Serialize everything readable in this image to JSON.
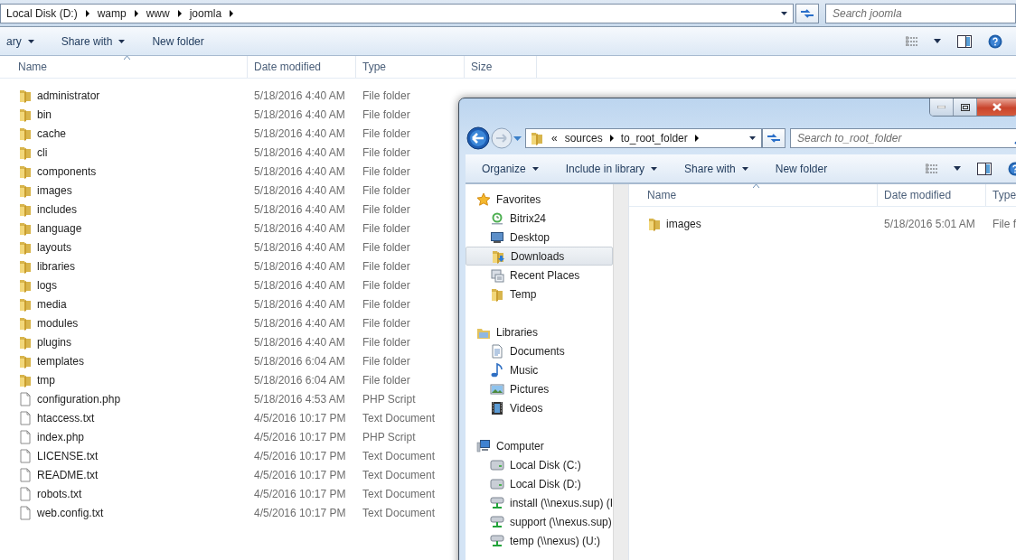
{
  "back_window": {
    "address_bar": {
      "breadcrumbs": [
        "Local Disk (D:)",
        "wamp",
        "www",
        "joomla"
      ]
    },
    "search": {
      "placeholder": "Search joomla"
    },
    "toolbar": [
      {
        "label": "ary",
        "dropdown": true
      },
      {
        "label": "Share with",
        "dropdown": true
      },
      {
        "label": "New folder",
        "dropdown": false
      }
    ],
    "columns": [
      {
        "label": "Name",
        "sorted": true
      },
      {
        "label": "Date modified",
        "sorted": false
      },
      {
        "label": "Type",
        "sorted": false
      },
      {
        "label": "Size",
        "sorted": false
      }
    ],
    "files": [
      {
        "name": "administrator",
        "date_modified": "5/18/2016 4:40 AM",
        "type": "File folder",
        "kind": "folder"
      },
      {
        "name": "bin",
        "date_modified": "5/18/2016 4:40 AM",
        "type": "File folder",
        "kind": "folder"
      },
      {
        "name": "cache",
        "date_modified": "5/18/2016 4:40 AM",
        "type": "File folder",
        "kind": "folder"
      },
      {
        "name": "cli",
        "date_modified": "5/18/2016 4:40 AM",
        "type": "File folder",
        "kind": "folder"
      },
      {
        "name": "components",
        "date_modified": "5/18/2016 4:40 AM",
        "type": "File folder",
        "kind": "folder"
      },
      {
        "name": "images",
        "date_modified": "5/18/2016 4:40 AM",
        "type": "File folder",
        "kind": "folder"
      },
      {
        "name": "includes",
        "date_modified": "5/18/2016 4:40 AM",
        "type": "File folder",
        "kind": "folder"
      },
      {
        "name": "language",
        "date_modified": "5/18/2016 4:40 AM",
        "type": "File folder",
        "kind": "folder"
      },
      {
        "name": "layouts",
        "date_modified": "5/18/2016 4:40 AM",
        "type": "File folder",
        "kind": "folder"
      },
      {
        "name": "libraries",
        "date_modified": "5/18/2016 4:40 AM",
        "type": "File folder",
        "kind": "folder"
      },
      {
        "name": "logs",
        "date_modified": "5/18/2016 4:40 AM",
        "type": "File folder",
        "kind": "folder"
      },
      {
        "name": "media",
        "date_modified": "5/18/2016 4:40 AM",
        "type": "File folder",
        "kind": "folder"
      },
      {
        "name": "modules",
        "date_modified": "5/18/2016 4:40 AM",
        "type": "File folder",
        "kind": "folder"
      },
      {
        "name": "plugins",
        "date_modified": "5/18/2016 4:40 AM",
        "type": "File folder",
        "kind": "folder"
      },
      {
        "name": "templates",
        "date_modified": "5/18/2016 6:04 AM",
        "type": "File folder",
        "kind": "folder"
      },
      {
        "name": "tmp",
        "date_modified": "5/18/2016 6:04 AM",
        "type": "File folder",
        "kind": "folder"
      },
      {
        "name": "configuration.php",
        "date_modified": "5/18/2016 4:53 AM",
        "type": "PHP Script",
        "kind": "file"
      },
      {
        "name": "htaccess.txt",
        "date_modified": "4/5/2016 10:17 PM",
        "type": "Text Document",
        "kind": "file"
      },
      {
        "name": "index.php",
        "date_modified": "4/5/2016 10:17 PM",
        "type": "PHP Script",
        "kind": "file"
      },
      {
        "name": "LICENSE.txt",
        "date_modified": "4/5/2016 10:17 PM",
        "type": "Text Document",
        "kind": "file"
      },
      {
        "name": "README.txt",
        "date_modified": "4/5/2016 10:17 PM",
        "type": "Text Document",
        "kind": "file"
      },
      {
        "name": "robots.txt",
        "date_modified": "4/5/2016 10:17 PM",
        "type": "Text Document",
        "kind": "file"
      },
      {
        "name": "web.config.txt",
        "date_modified": "4/5/2016 10:17 PM",
        "type": "Text Document",
        "kind": "file"
      }
    ]
  },
  "front_window": {
    "address_bar": {
      "overflow_marker": "«",
      "breadcrumbs": [
        "sources",
        "to_root_folder"
      ]
    },
    "search": {
      "placeholder": "Search to_root_folder"
    },
    "toolbar": [
      {
        "label": "Organize",
        "dropdown": true
      },
      {
        "label": "Include in library",
        "dropdown": true
      },
      {
        "label": "Share with",
        "dropdown": true
      },
      {
        "label": "New folder",
        "dropdown": false
      }
    ],
    "navigation": [
      {
        "label": "Favorites",
        "kind": "star",
        "children": [
          {
            "label": "Bitrix24",
            "kind": "app",
            "selected": false
          },
          {
            "label": "Desktop",
            "kind": "desktop",
            "selected": false
          },
          {
            "label": "Downloads",
            "kind": "downloads",
            "selected": true
          },
          {
            "label": "Recent Places",
            "kind": "recent",
            "selected": false
          },
          {
            "label": "Temp",
            "kind": "folder",
            "selected": false
          }
        ]
      },
      {
        "label": "Libraries",
        "kind": "library",
        "children": [
          {
            "label": "Documents",
            "kind": "document",
            "selected": false
          },
          {
            "label": "Music",
            "kind": "music",
            "selected": false
          },
          {
            "label": "Pictures",
            "kind": "pictures",
            "selected": false
          },
          {
            "label": "Videos",
            "kind": "videos",
            "selected": false
          }
        ]
      },
      {
        "label": "Computer",
        "kind": "computer",
        "children": [
          {
            "label": "Local Disk (C:)",
            "kind": "disk",
            "selected": false
          },
          {
            "label": "Local Disk (D:)",
            "kind": "disk",
            "selected": false
          },
          {
            "label": "install (\\\\nexus.sup) (I",
            "kind": "network",
            "selected": false
          },
          {
            "label": "support (\\\\nexus.sup)",
            "kind": "network",
            "selected": false
          },
          {
            "label": "temp (\\\\nexus) (U:)",
            "kind": "network",
            "selected": false
          }
        ]
      }
    ],
    "columns": [
      {
        "label": "Name",
        "sorted": true
      },
      {
        "label": "Date modified",
        "sorted": false
      },
      {
        "label": "Type",
        "sorted": false
      }
    ],
    "files": [
      {
        "name": "images",
        "date_modified": "5/18/2016 5:01 AM",
        "type": "File f",
        "kind": "folder"
      }
    ]
  }
}
